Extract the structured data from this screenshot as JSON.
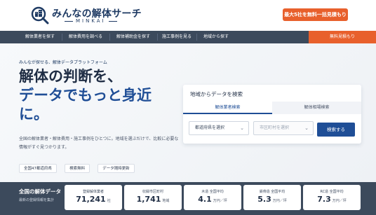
{
  "header": {
    "logo_text": "みんなの解体サーチ",
    "logo_sub": "MINKAI",
    "cta_label": "最大5社を無料一括見積もり"
  },
  "nav": {
    "items": [
      "解体業者を探す",
      "解体費用を調べる",
      "解体補助金を探す",
      "施工事例を見る",
      "地域から探す"
    ],
    "cta_label": "無料見積もり"
  },
  "hero": {
    "tagline": "みんなが探せる、解体データプラットフォーム",
    "headline_line1": "解体の判断を、",
    "headline_line2": "データでもっと身近",
    "headline_line3": "に。",
    "description": "全国の解体業者・解体費用・施工事例をひとつに。地域を選ぶだけで、比較に必要な情報がすぐ見つかります。",
    "tags": [
      "全国47都道府県",
      "検索無料",
      "データ随時更新"
    ]
  },
  "search_card": {
    "title": "地域からデータを検索",
    "tabs": [
      "解体業者検索",
      "解体相場検索"
    ],
    "active_tab": 0,
    "prefecture_placeholder": "都道府県を選択",
    "city_placeholder": "市区町村を選択",
    "search_label": "検索する"
  },
  "stats": {
    "label": "全国の解体データ",
    "sub_label": "最新の登録情報を集計",
    "items": [
      {
        "title": "登録解体業者",
        "value": "71,241",
        "unit": "社"
      },
      {
        "title": "収録市区町村",
        "value": "1,741",
        "unit": "地域"
      },
      {
        "title": "木造 全国平均",
        "value": "4.1",
        "unit": "万円／坪"
      },
      {
        "title": "鉄骨造 全国平均",
        "value": "5.3",
        "unit": "万円／坪"
      },
      {
        "title": "RC造 全国平均",
        "value": "7.3",
        "unit": "万円／坪"
      }
    ]
  },
  "colors": {
    "brand_navy": "#1f4e96",
    "accent_orange": "#e8602c",
    "nav_bg": "#3c4a5c"
  }
}
